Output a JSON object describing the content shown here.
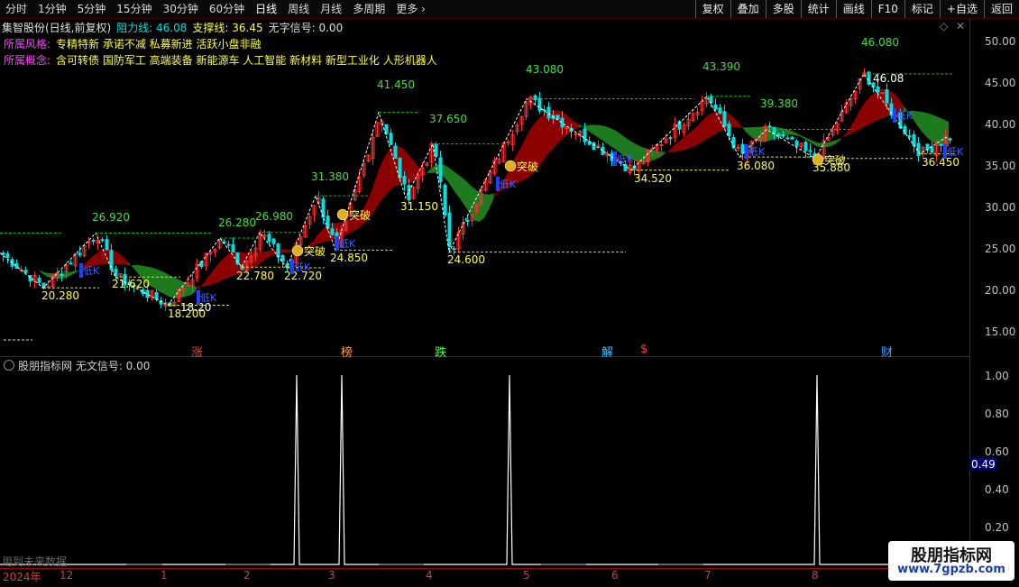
{
  "toolbar": {
    "periods": [
      "分时",
      "1分钟",
      "5分钟",
      "15分钟",
      "30分钟",
      "60分钟",
      "日线",
      "周线",
      "月线",
      "多周期",
      "更多 ›"
    ],
    "active_period": "日线",
    "tools": [
      "复权",
      "叠加",
      "多股",
      "统计",
      "画线",
      "F10",
      "标记",
      "+自选",
      "返回"
    ]
  },
  "header": {
    "title": "集智股份(日线,前复权)",
    "resistance": "阻力线: 46.08",
    "support": "支撑线: 36.45",
    "no_signal": "无字信号: 0.00",
    "style_label": "所属风格:",
    "style_value": "专精特新 承诺不减 私募新进 活跃小盘非融",
    "concept_label": "所属概念:",
    "concept_value": "含可转债 国防军工 高端装备 新能源车 人工智能 新材料 新型工业化 人形机器人"
  },
  "main_axis": [
    "50.00",
    "45.00",
    "40.00",
    "35.00",
    "30.00",
    "25.00",
    "20.00",
    "15.00"
  ],
  "sub_axis": [
    "1.00",
    "0.80",
    "0.60",
    "0.40",
    "0.20"
  ],
  "sub_header": "股朋指标网 无文信号: 0.00",
  "sub_current": "0.49",
  "dates": [
    "2024年",
    "12",
    "1",
    "2",
    "3",
    "4",
    "5",
    "6",
    "7",
    "8"
  ],
  "future_text": "用到未来数据",
  "watermark": {
    "name": "股朋指标网",
    "url": "www.7gpzb.com"
  },
  "event_marks": [
    {
      "text": "涨",
      "color": "#ff4040"
    },
    {
      "text": "榜",
      "color": "#ffa040"
    },
    {
      "text": "跌",
      "color": "#40ff40"
    },
    {
      "text": "解",
      "color": "#40c0ff"
    },
    {
      "text": "$",
      "color": "#ff4040"
    },
    {
      "text": "财",
      "color": "#40a0ff"
    }
  ],
  "peak_labels": [
    "26.920",
    "26.280",
    "26.980",
    "31.380",
    "41.450",
    "37.650",
    "43.080",
    "43.390",
    "39.380",
    "46.080",
    "46.08"
  ],
  "trough_labels": [
    "20.280",
    "21.620",
    "18.200",
    "22.780",
    "22.720",
    "24.850",
    "31.150",
    "24.600",
    "34.520",
    "36.080",
    "35.880",
    "36.450",
    "18.20"
  ],
  "breakout_text": "突破",
  "pivot_label": "低K",
  "colors": {
    "up": "#ff3030",
    "down": "#00e0e0",
    "band_up": "#8b0000",
    "band_down": "#1e7a1e",
    "zig": "#ffffff",
    "resist": "#00c000",
    "support": "#e0e000"
  }
}
